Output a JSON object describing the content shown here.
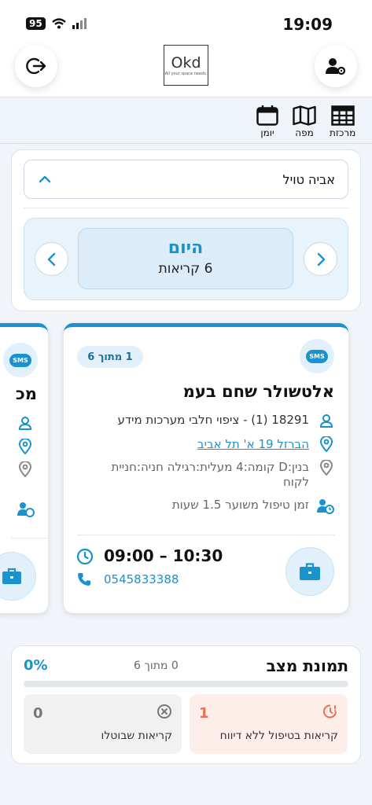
{
  "status_bar": {
    "time": "19:09",
    "battery": "95"
  },
  "header": {
    "logo_text": "Okd",
    "logo_tagline": "All your space needs."
  },
  "tabs": [
    {
      "label": "מרכזת",
      "icon": "grid-icon"
    },
    {
      "label": "מפה",
      "icon": "map-icon"
    },
    {
      "label": "יומן",
      "icon": "calendar-icon"
    }
  ],
  "filter": {
    "technician": "אביה טויל",
    "day_title": "היום",
    "day_count": "6 קריאות"
  },
  "job_card": {
    "badge": "1 מתוך 6",
    "customer": "אלטשולר שחם בעמ",
    "service": "18291 (1) - ציפוי חלבי מערכות מידע",
    "address": "הברזל 19 א'  תל אביב",
    "location_details": "בנין:D קומה:4 מעלית:רגילה חניה:חניית לקוח",
    "duration": "זמן טיפול משוער 1.5 שעות",
    "time_range": "09:00 – 10:30",
    "phone": "0545833388",
    "sms_label": "SMS"
  },
  "next_card": {
    "customer_partial": "מכ"
  },
  "summary": {
    "title": "תמונת מצב",
    "count": "0 מתוך 6",
    "percent": "0%",
    "progress": 0,
    "pending": {
      "value": "1",
      "label": "קריאות בטיפול ללא דיווח"
    },
    "cancelled": {
      "value": "0",
      "label": "קריאות שבוטלו"
    }
  },
  "colors": {
    "accent": "#1a92cd",
    "warning": "#e8714f"
  }
}
